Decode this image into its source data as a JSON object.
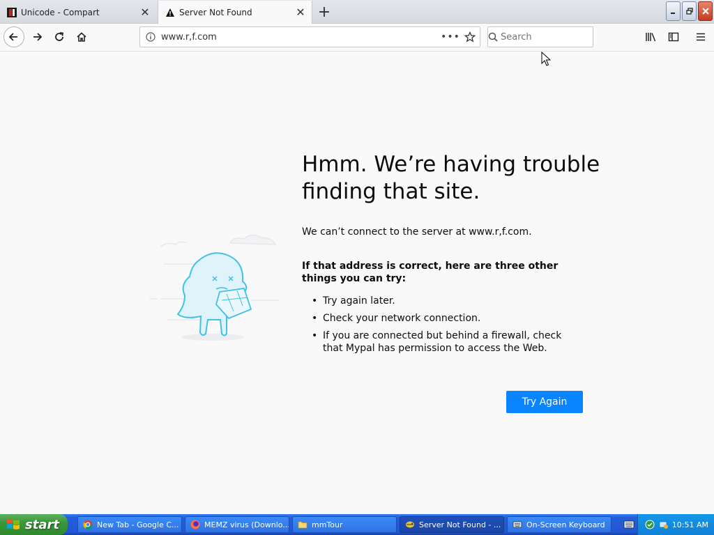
{
  "tabs": [
    {
      "label": "Unicode - Compart",
      "icon": "compart-favicon"
    },
    {
      "label": "Server Not Found",
      "icon": "warning-icon"
    }
  ],
  "nav": {
    "url": "www.r,f.com",
    "search_placeholder": "Search"
  },
  "error": {
    "title": "Hmm. We’re having trouble finding that site.",
    "description": "We can’t connect to the server at www.r,f.com.",
    "subhead": "If that address is correct, here are three other things you can try:",
    "tips": [
      "Try again later.",
      "Check your network connection.",
      "If you are connected but behind a firewall, check that Mypal has permission to access the Web."
    ],
    "button_label": "Try Again"
  },
  "taskbar": {
    "start_label": "start",
    "items": [
      {
        "label": "New Tab - Google C...",
        "icon": "chrome-icon"
      },
      {
        "label": "MEMZ virus (Downlo...",
        "icon": "firefox-icon"
      },
      {
        "label": "mmTour",
        "icon": "folder-icon"
      },
      {
        "label": "Server Not Found - ...",
        "icon": "mypal-icon"
      },
      {
        "label": "On-Screen Keyboard",
        "icon": "keyboard-icon"
      }
    ],
    "clock": "10:51 AM"
  },
  "colors": {
    "accent": "#0a84ff",
    "taskbar": "#245edb",
    "start": "#3c963c"
  }
}
